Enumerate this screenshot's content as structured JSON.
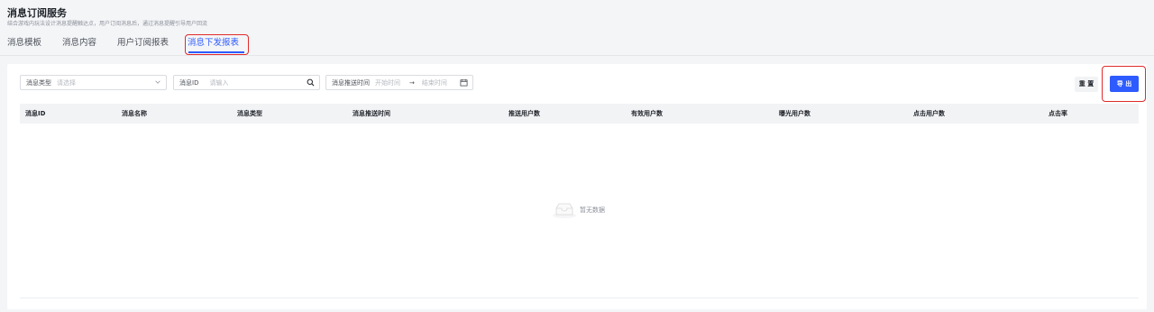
{
  "header": {
    "title": "消息订阅服务",
    "subtitle": "结合游戏内玩法设计消息提醒触达点，用户订阅消息后，通过消息提醒引导用户回流"
  },
  "tabs": [
    {
      "label": "消息模板",
      "active": false
    },
    {
      "label": "消息内容",
      "active": false
    },
    {
      "label": "用户订阅报表",
      "active": false
    },
    {
      "label": "消息下发报表",
      "active": true
    }
  ],
  "filters": {
    "type": {
      "label": "消息类型",
      "placeholder": "请选择"
    },
    "id": {
      "label": "消息ID",
      "placeholder": "请输入"
    },
    "time": {
      "label": "消息推送时间",
      "start_placeholder": "开始时间",
      "end_placeholder": "结束时间",
      "separator": "→"
    }
  },
  "buttons": {
    "reset": "重 置",
    "export": "导 出"
  },
  "table": {
    "columns": [
      "消息ID",
      "消息名称",
      "消息类型",
      "消息推送时间",
      "推送用户数",
      "有效用户数",
      "曝光用户数",
      "点击用户数",
      "点击率"
    ],
    "rows": [],
    "empty_text": "暂无数据"
  },
  "colors": {
    "accent": "#2e5bff",
    "highlight": "#e02b2b"
  }
}
